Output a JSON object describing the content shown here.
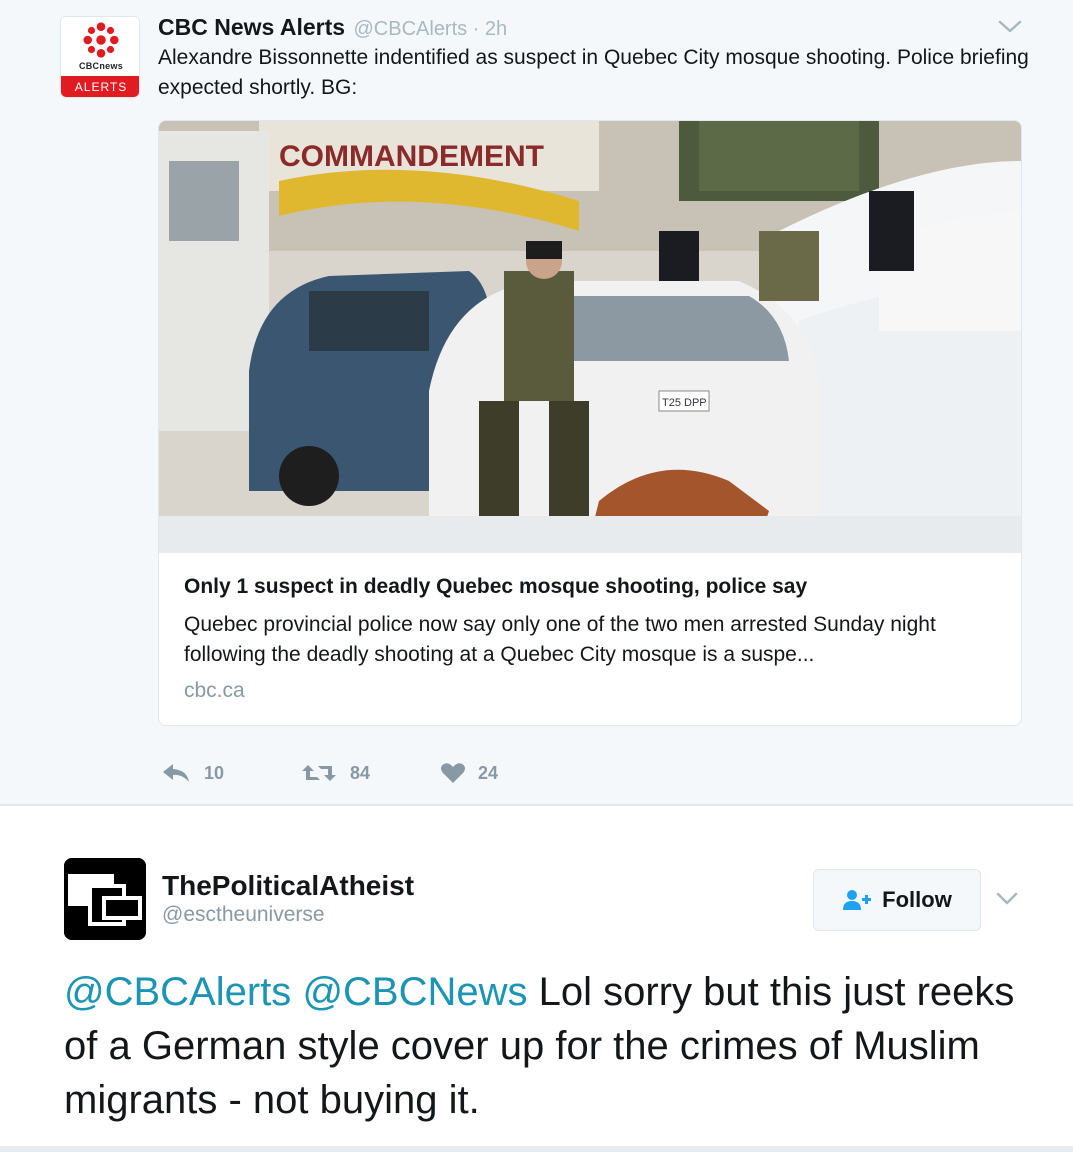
{
  "colors": {
    "brand_red": "#e01b22",
    "link": "#1b95b3",
    "muted": "#8899a6",
    "handle_light": "#aab8c2",
    "parent_bg": "#f5f8fa"
  },
  "tweet": {
    "author_name": "CBC News Alerts",
    "author_handle": "@CBCAlerts · 2h",
    "avatar": {
      "brand_text": "CBCnews",
      "badge_text": "ALERTS",
      "icon": "cbc-gem-icon"
    },
    "menu_icon": "chevron-down-icon",
    "text": "Alexandre Bissonnette indentified as suspect in Quebec City mosque shooting. Police briefing expected shortly. BG:",
    "card": {
      "image_sign_text": "COMMANDEMENT",
      "image_plate_text": "T25 DPP",
      "title": "Only 1 suspect in deadly Quebec mosque shooting, police say",
      "description": "Quebec provincial police now say only one of the two men arrested Sunday night following the deadly shooting at a Quebec City mosque is a suspe...",
      "domain": "cbc.ca"
    },
    "actions": {
      "replies": "10",
      "retweets": "84",
      "likes": "24",
      "reply_icon": "reply-icon",
      "retweet_icon": "retweet-icon",
      "like_icon": "heart-icon"
    }
  },
  "reply": {
    "author_name": "ThePoliticalAtheist",
    "author_handle": "@esctheuniverse",
    "follow_label": "Follow",
    "follow_icon": "add-user-icon",
    "menu_icon": "chevron-down-icon",
    "mention_1": "@CBCAlerts",
    "mention_2": "@CBCNews",
    "body": "Lol sorry but this just reeks of a German style cover up for the crimes of Muslim migrants - not buying it."
  }
}
